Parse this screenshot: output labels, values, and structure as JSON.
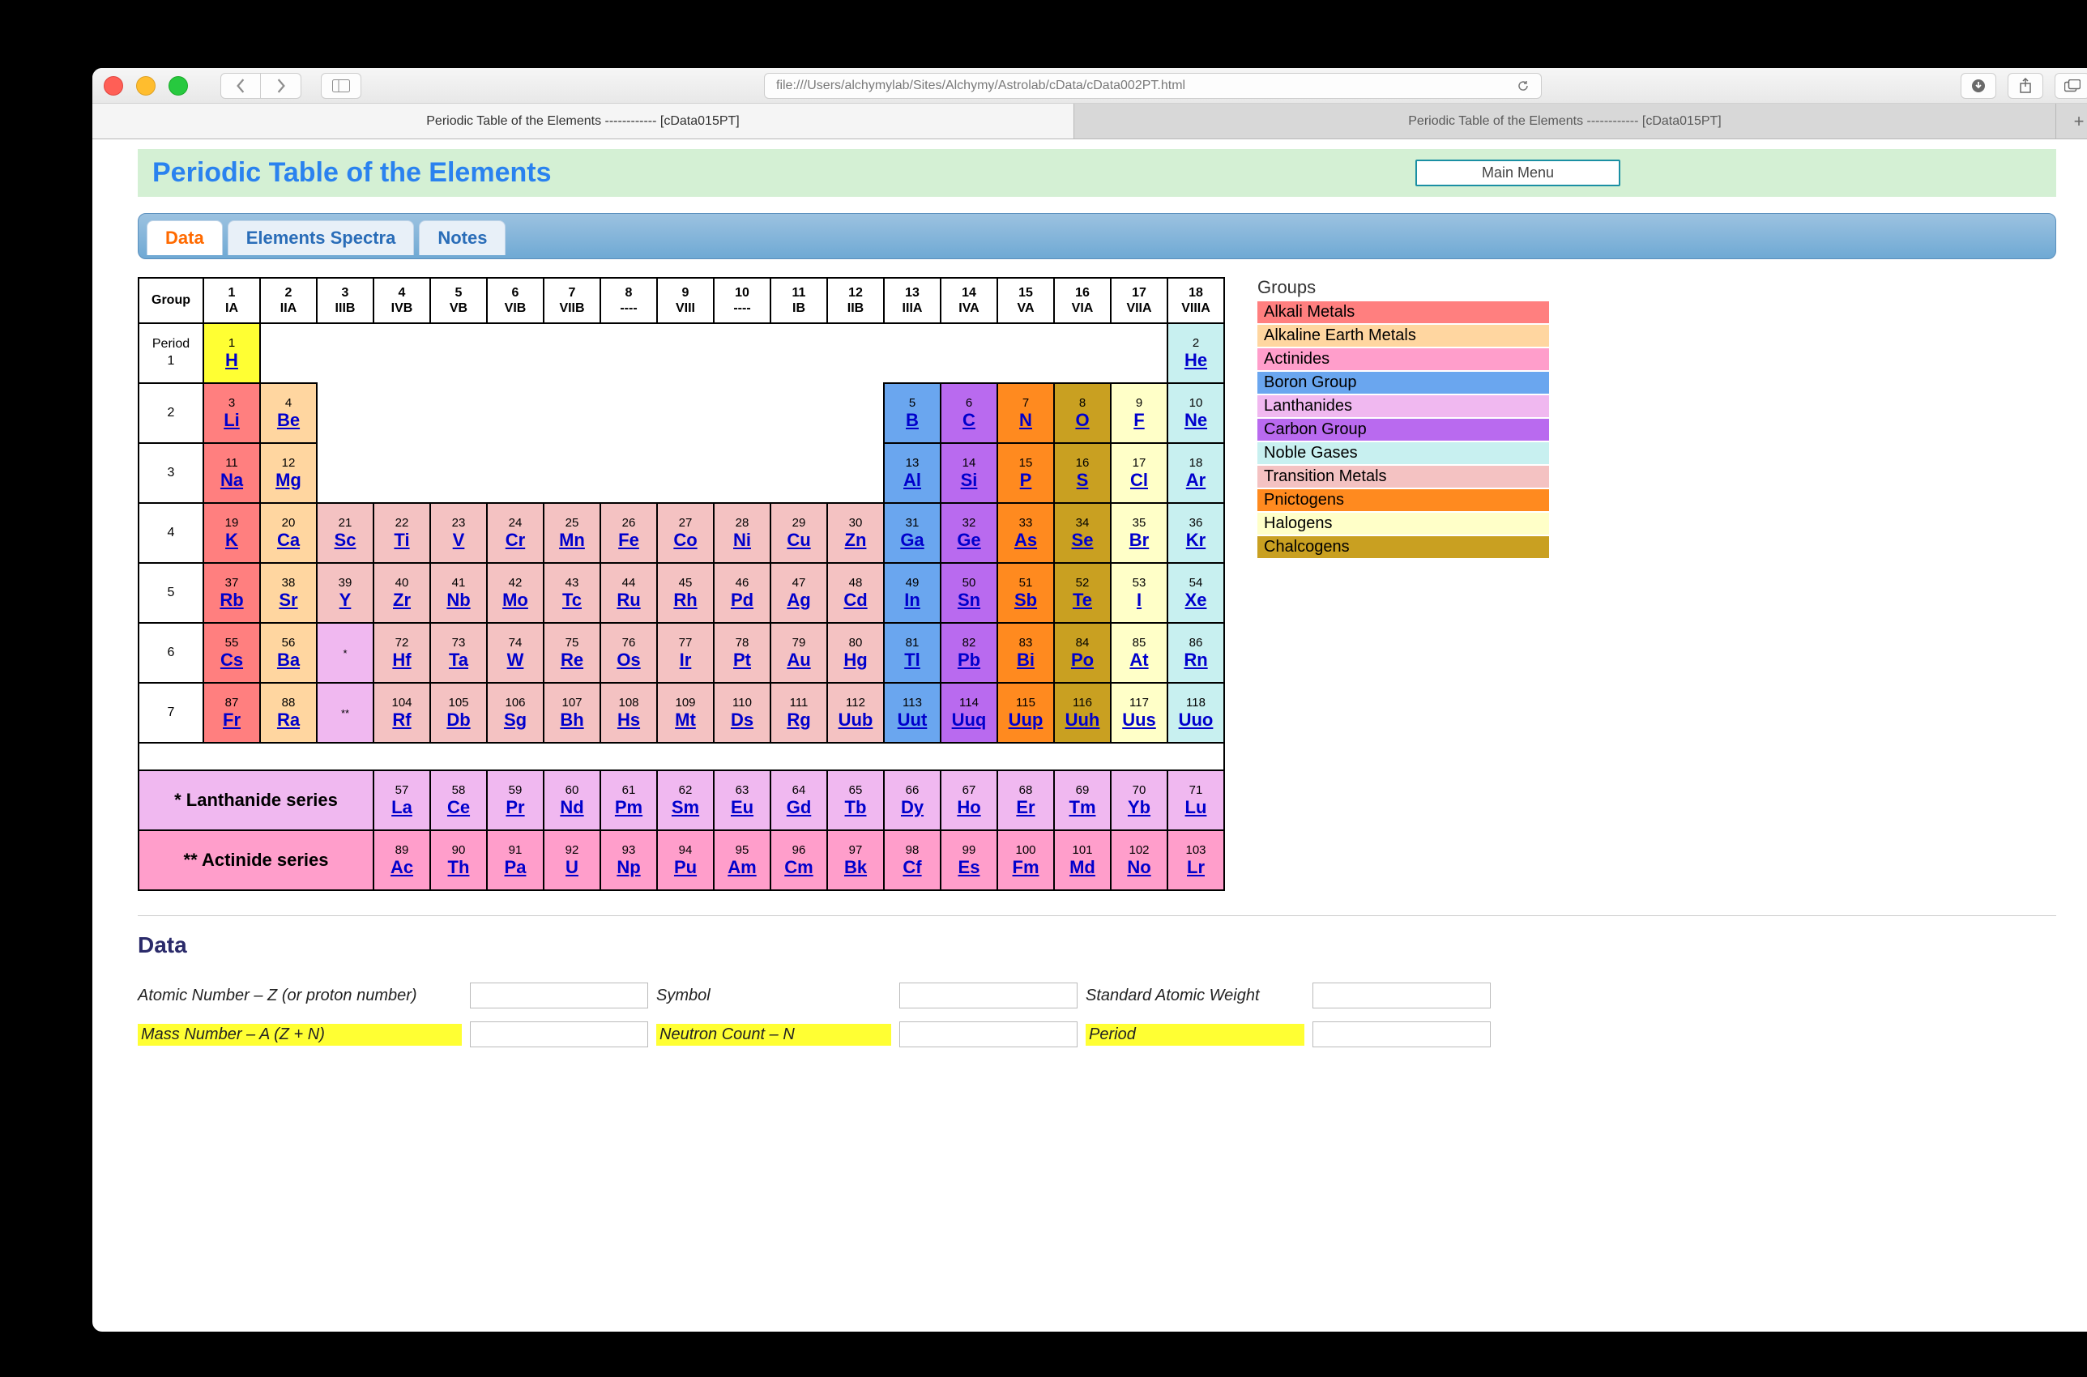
{
  "url": "file:///Users/alchymylab/Sites/Alchymy/Astrolab/cData/cData002PT.html",
  "browser_tabs": [
    "Periodic Table of the Elements ------------ [cData015PT]",
    "Periodic Table of the Elements ------------ [cData015PT]"
  ],
  "page_title": "Periodic Table of the Elements",
  "main_menu_label": "Main Menu",
  "uitabs": [
    "Data",
    "Elements Spectra",
    "Notes"
  ],
  "group_header_label": "Group",
  "period_header_label": "Period",
  "groups": [
    {
      "n": "1",
      "r": "IA"
    },
    {
      "n": "2",
      "r": "IIA"
    },
    {
      "n": "3",
      "r": "IIIB"
    },
    {
      "n": "4",
      "r": "IVB"
    },
    {
      "n": "5",
      "r": "VB"
    },
    {
      "n": "6",
      "r": "VIB"
    },
    {
      "n": "7",
      "r": "VIIB"
    },
    {
      "n": "8",
      "r": "----"
    },
    {
      "n": "9",
      "r": "VIII"
    },
    {
      "n": "10",
      "r": "----"
    },
    {
      "n": "11",
      "r": "IB"
    },
    {
      "n": "12",
      "r": "IIB"
    },
    {
      "n": "13",
      "r": "IIIA"
    },
    {
      "n": "14",
      "r": "IVA"
    },
    {
      "n": "15",
      "r": "VA"
    },
    {
      "n": "16",
      "r": "VIA"
    },
    {
      "n": "17",
      "r": "VIIA"
    },
    {
      "n": "18",
      "r": "VIIIA"
    }
  ],
  "periods_side": [
    "1",
    "2",
    "3",
    "4",
    "5",
    "6",
    "7"
  ],
  "elements": {
    "1": {
      "s": "H",
      "c": "c-yellow"
    },
    "2": {
      "s": "He",
      "c": "c-noble"
    },
    "3": {
      "s": "Li",
      "c": "c-alkali"
    },
    "4": {
      "s": "Be",
      "c": "c-alkearth"
    },
    "5": {
      "s": "B",
      "c": "c-boron"
    },
    "6": {
      "s": "C",
      "c": "c-carbon"
    },
    "7": {
      "s": "N",
      "c": "c-pnict"
    },
    "8": {
      "s": "O",
      "c": "c-chalc"
    },
    "9": {
      "s": "F",
      "c": "c-halog"
    },
    "10": {
      "s": "Ne",
      "c": "c-noble"
    },
    "11": {
      "s": "Na",
      "c": "c-alkali"
    },
    "12": {
      "s": "Mg",
      "c": "c-alkearth"
    },
    "13": {
      "s": "Al",
      "c": "c-boron"
    },
    "14": {
      "s": "Si",
      "c": "c-carbon"
    },
    "15": {
      "s": "P",
      "c": "c-pnict"
    },
    "16": {
      "s": "S",
      "c": "c-chalc"
    },
    "17": {
      "s": "Cl",
      "c": "c-halog"
    },
    "18": {
      "s": "Ar",
      "c": "c-noble"
    },
    "19": {
      "s": "K",
      "c": "c-alkali"
    },
    "20": {
      "s": "Ca",
      "c": "c-alkearth"
    },
    "21": {
      "s": "Sc",
      "c": "c-trans"
    },
    "22": {
      "s": "Ti",
      "c": "c-trans"
    },
    "23": {
      "s": "V",
      "c": "c-trans"
    },
    "24": {
      "s": "Cr",
      "c": "c-trans"
    },
    "25": {
      "s": "Mn",
      "c": "c-trans"
    },
    "26": {
      "s": "Fe",
      "c": "c-trans"
    },
    "27": {
      "s": "Co",
      "c": "c-trans"
    },
    "28": {
      "s": "Ni",
      "c": "c-trans"
    },
    "29": {
      "s": "Cu",
      "c": "c-trans"
    },
    "30": {
      "s": "Zn",
      "c": "c-trans"
    },
    "31": {
      "s": "Ga",
      "c": "c-boron"
    },
    "32": {
      "s": "Ge",
      "c": "c-carbon"
    },
    "33": {
      "s": "As",
      "c": "c-pnict"
    },
    "34": {
      "s": "Se",
      "c": "c-chalc"
    },
    "35": {
      "s": "Br",
      "c": "c-halog"
    },
    "36": {
      "s": "Kr",
      "c": "c-noble"
    },
    "37": {
      "s": "Rb",
      "c": "c-alkali"
    },
    "38": {
      "s": "Sr",
      "c": "c-alkearth"
    },
    "39": {
      "s": "Y",
      "c": "c-trans"
    },
    "40": {
      "s": "Zr",
      "c": "c-trans"
    },
    "41": {
      "s": "Nb",
      "c": "c-trans"
    },
    "42": {
      "s": "Mo",
      "c": "c-trans"
    },
    "43": {
      "s": "Tc",
      "c": "c-trans"
    },
    "44": {
      "s": "Ru",
      "c": "c-trans"
    },
    "45": {
      "s": "Rh",
      "c": "c-trans"
    },
    "46": {
      "s": "Pd",
      "c": "c-trans"
    },
    "47": {
      "s": "Ag",
      "c": "c-trans"
    },
    "48": {
      "s": "Cd",
      "c": "c-trans"
    },
    "49": {
      "s": "In",
      "c": "c-boron"
    },
    "50": {
      "s": "Sn",
      "c": "c-carbon"
    },
    "51": {
      "s": "Sb",
      "c": "c-pnict"
    },
    "52": {
      "s": "Te",
      "c": "c-chalc"
    },
    "53": {
      "s": "I",
      "c": "c-halog"
    },
    "54": {
      "s": "Xe",
      "c": "c-noble"
    },
    "55": {
      "s": "Cs",
      "c": "c-alkali"
    },
    "56": {
      "s": "Ba",
      "c": "c-alkearth"
    },
    "72": {
      "s": "Hf",
      "c": "c-trans"
    },
    "73": {
      "s": "Ta",
      "c": "c-trans"
    },
    "74": {
      "s": "W",
      "c": "c-trans"
    },
    "75": {
      "s": "Re",
      "c": "c-trans"
    },
    "76": {
      "s": "Os",
      "c": "c-trans"
    },
    "77": {
      "s": "Ir",
      "c": "c-trans"
    },
    "78": {
      "s": "Pt",
      "c": "c-trans"
    },
    "79": {
      "s": "Au",
      "c": "c-trans"
    },
    "80": {
      "s": "Hg",
      "c": "c-trans"
    },
    "81": {
      "s": "Tl",
      "c": "c-boron"
    },
    "82": {
      "s": "Pb",
      "c": "c-carbon"
    },
    "83": {
      "s": "Bi",
      "c": "c-pnict"
    },
    "84": {
      "s": "Po",
      "c": "c-chalc"
    },
    "85": {
      "s": "At",
      "c": "c-halog"
    },
    "86": {
      "s": "Rn",
      "c": "c-noble"
    },
    "87": {
      "s": "Fr",
      "c": "c-alkali"
    },
    "88": {
      "s": "Ra",
      "c": "c-alkearth"
    },
    "104": {
      "s": "Rf",
      "c": "c-trans"
    },
    "105": {
      "s": "Db",
      "c": "c-trans"
    },
    "106": {
      "s": "Sg",
      "c": "c-trans"
    },
    "107": {
      "s": "Bh",
      "c": "c-trans"
    },
    "108": {
      "s": "Hs",
      "c": "c-trans"
    },
    "109": {
      "s": "Mt",
      "c": "c-trans"
    },
    "110": {
      "s": "Ds",
      "c": "c-trans"
    },
    "111": {
      "s": "Rg",
      "c": "c-trans"
    },
    "112": {
      "s": "Uub",
      "c": "c-trans"
    },
    "113": {
      "s": "Uut",
      "c": "c-boron"
    },
    "114": {
      "s": "Uuq",
      "c": "c-carbon"
    },
    "115": {
      "s": "Uup",
      "c": "c-pnict"
    },
    "116": {
      "s": "Uuh",
      "c": "c-chalc"
    },
    "117": {
      "s": "Uus",
      "c": "c-halog"
    },
    "118": {
      "s": "Uuo",
      "c": "c-noble"
    },
    "57": {
      "s": "La",
      "c": "c-lanth"
    },
    "58": {
      "s": "Ce",
      "c": "c-lanth"
    },
    "59": {
      "s": "Pr",
      "c": "c-lanth"
    },
    "60": {
      "s": "Nd",
      "c": "c-lanth"
    },
    "61": {
      "s": "Pm",
      "c": "c-lanth"
    },
    "62": {
      "s": "Sm",
      "c": "c-lanth"
    },
    "63": {
      "s": "Eu",
      "c": "c-lanth"
    },
    "64": {
      "s": "Gd",
      "c": "c-lanth"
    },
    "65": {
      "s": "Tb",
      "c": "c-lanth"
    },
    "66": {
      "s": "Dy",
      "c": "c-lanth"
    },
    "67": {
      "s": "Ho",
      "c": "c-lanth"
    },
    "68": {
      "s": "Er",
      "c": "c-lanth"
    },
    "69": {
      "s": "Tm",
      "c": "c-lanth"
    },
    "70": {
      "s": "Yb",
      "c": "c-lanth"
    },
    "71": {
      "s": "Lu",
      "c": "c-lanth"
    },
    "89": {
      "s": "Ac",
      "c": "c-actinide"
    },
    "90": {
      "s": "Th",
      "c": "c-actinide"
    },
    "91": {
      "s": "Pa",
      "c": "c-actinide"
    },
    "92": {
      "s": "U",
      "c": "c-actinide"
    },
    "93": {
      "s": "Np",
      "c": "c-actinide"
    },
    "94": {
      "s": "Pu",
      "c": "c-actinide"
    },
    "95": {
      "s": "Am",
      "c": "c-actinide"
    },
    "96": {
      "s": "Cm",
      "c": "c-actinide"
    },
    "97": {
      "s": "Bk",
      "c": "c-actinide"
    },
    "98": {
      "s": "Cf",
      "c": "c-actinide"
    },
    "99": {
      "s": "Es",
      "c": "c-actinide"
    },
    "100": {
      "s": "Fm",
      "c": "c-actinide"
    },
    "101": {
      "s": "Md",
      "c": "c-actinide"
    },
    "102": {
      "s": "No",
      "c": "c-actinide"
    },
    "103": {
      "s": "Lr",
      "c": "c-actinide"
    }
  },
  "layout": [
    [
      1,
      null,
      null,
      null,
      null,
      null,
      null,
      null,
      null,
      null,
      null,
      null,
      null,
      null,
      null,
      null,
      null,
      2
    ],
    [
      3,
      4,
      null,
      null,
      null,
      null,
      null,
      null,
      null,
      null,
      null,
      null,
      5,
      6,
      7,
      8,
      9,
      10
    ],
    [
      11,
      12,
      null,
      null,
      null,
      null,
      null,
      null,
      null,
      null,
      null,
      null,
      13,
      14,
      15,
      16,
      17,
      18
    ],
    [
      19,
      20,
      21,
      22,
      23,
      24,
      25,
      26,
      27,
      28,
      29,
      30,
      31,
      32,
      33,
      34,
      35,
      36
    ],
    [
      37,
      38,
      39,
      40,
      41,
      42,
      43,
      44,
      45,
      46,
      47,
      48,
      49,
      50,
      51,
      52,
      53,
      54
    ],
    [
      55,
      56,
      "*",
      72,
      73,
      74,
      75,
      76,
      77,
      78,
      79,
      80,
      81,
      82,
      83,
      84,
      85,
      86
    ],
    [
      87,
      88,
      "**",
      104,
      105,
      106,
      107,
      108,
      109,
      110,
      111,
      112,
      113,
      114,
      115,
      116,
      117,
      118
    ]
  ],
  "lanth_label": "* Lanthanide series",
  "act_label": "** Actinide series",
  "lanth_row": [
    57,
    58,
    59,
    60,
    61,
    62,
    63,
    64,
    65,
    66,
    67,
    68,
    69,
    70,
    71
  ],
  "act_row": [
    89,
    90,
    91,
    92,
    93,
    94,
    95,
    96,
    97,
    98,
    99,
    100,
    101,
    102,
    103
  ],
  "legend_title": "Groups",
  "legend": [
    {
      "t": "Alkali Metals",
      "c": "c-alkali"
    },
    {
      "t": "Alkaline Earth Metals",
      "c": "c-alkearth"
    },
    {
      "t": "Actinides",
      "c": "c-actinide"
    },
    {
      "t": "Boron Group",
      "c": "c-boron"
    },
    {
      "t": "Lanthanides",
      "c": "c-lanth"
    },
    {
      "t": "Carbon Group",
      "c": "c-carbon"
    },
    {
      "t": "Noble Gases",
      "c": "c-noble"
    },
    {
      "t": "Transition Metals",
      "c": "c-trans"
    },
    {
      "t": "Pnictogens",
      "c": "c-pnict"
    },
    {
      "t": "Halogens",
      "c": "c-halog"
    },
    {
      "t": "Chalcogens",
      "c": "c-chalc"
    }
  ],
  "data_section_title": "Data",
  "data_fields_row1": [
    "Atomic Number – Z (or proton number)",
    "Symbol",
    "Standard Atomic Weight"
  ],
  "data_fields_row2": [
    "Mass Number – A (Z + N)",
    "Neutron Count – N",
    "Period"
  ]
}
